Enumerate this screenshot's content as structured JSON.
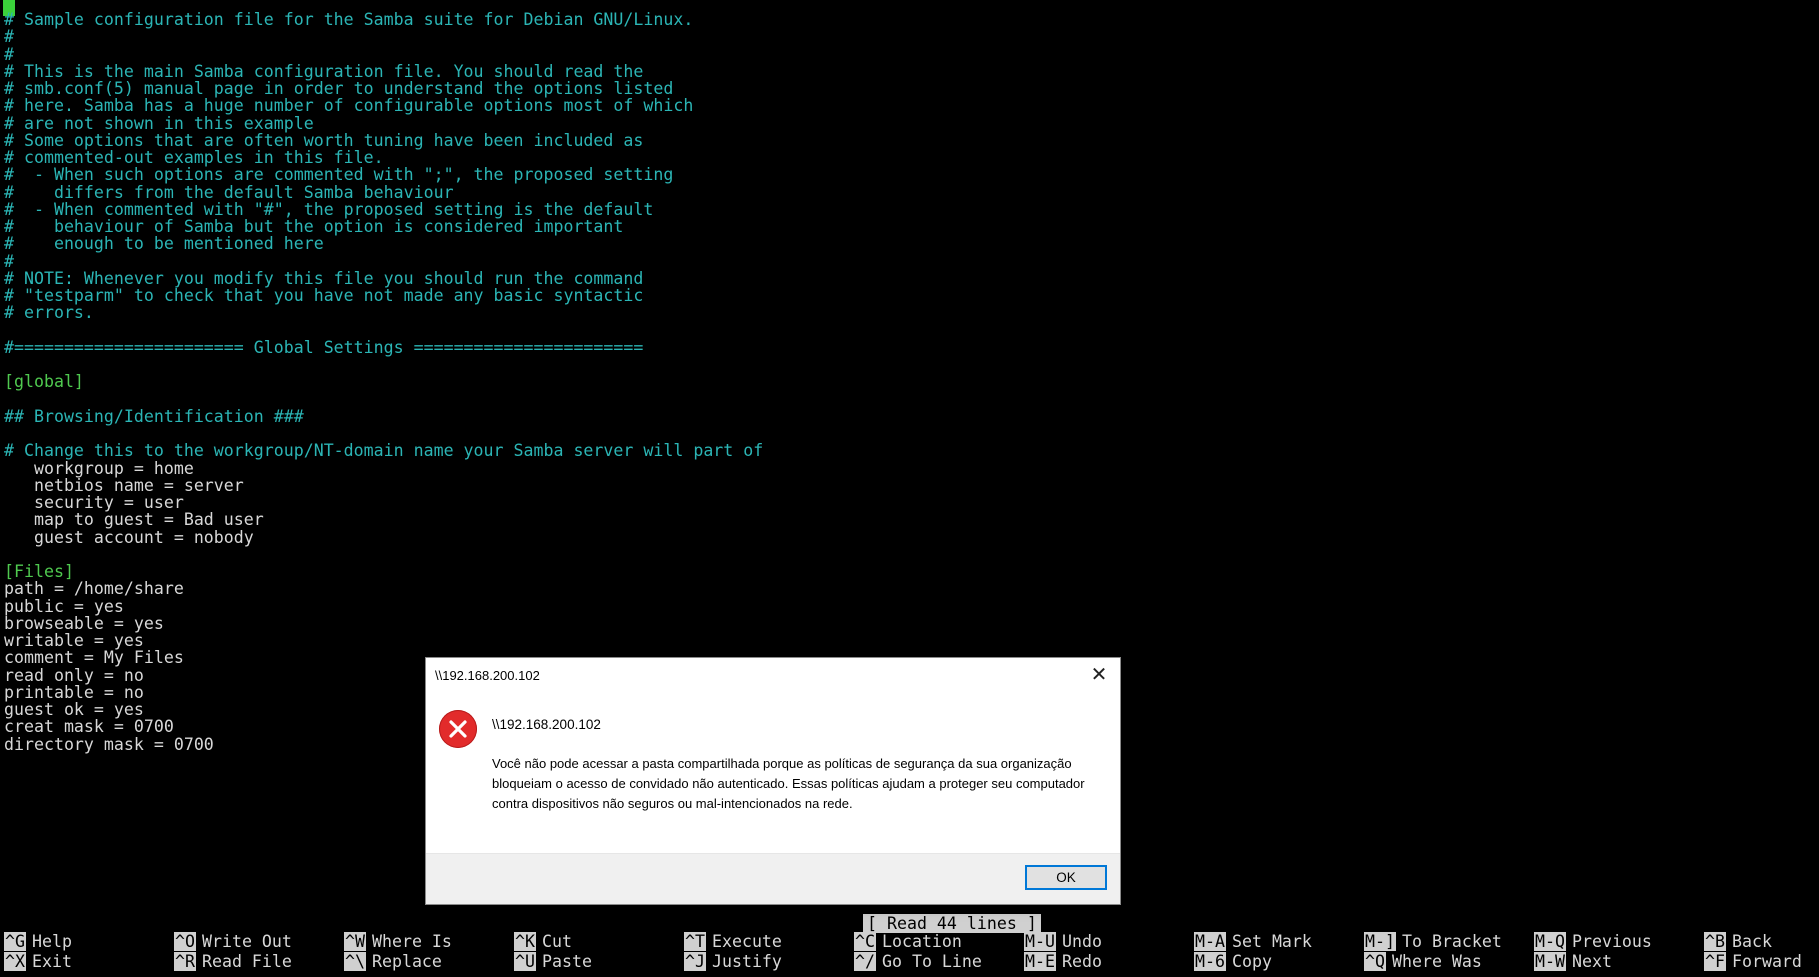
{
  "editor": {
    "cursor_char": "#",
    "lines": [
      {
        "text": "# Sample configuration file for the Samba suite for Debian GNU/Linux.",
        "color": "cyan"
      },
      {
        "text": "#",
        "color": "cyan"
      },
      {
        "text": "#",
        "color": "cyan"
      },
      {
        "text": "# This is the main Samba configuration file. You should read the",
        "color": "cyan"
      },
      {
        "text": "# smb.conf(5) manual page in order to understand the options listed",
        "color": "cyan"
      },
      {
        "text": "# here. Samba has a huge number of configurable options most of which",
        "color": "cyan"
      },
      {
        "text": "# are not shown in this example",
        "color": "cyan"
      },
      {
        "text": "# Some options that are often worth tuning have been included as",
        "color": "cyan"
      },
      {
        "text": "# commented-out examples in this file.",
        "color": "cyan"
      },
      {
        "text": "#  - When such options are commented with \";\", the proposed setting",
        "color": "cyan"
      },
      {
        "text": "#    differs from the default Samba behaviour",
        "color": "cyan"
      },
      {
        "text": "#  - When commented with \"#\", the proposed setting is the default",
        "color": "cyan"
      },
      {
        "text": "#    behaviour of Samba but the option is considered important",
        "color": "cyan"
      },
      {
        "text": "#    enough to be mentioned here",
        "color": "cyan"
      },
      {
        "text": "#",
        "color": "cyan"
      },
      {
        "text": "# NOTE: Whenever you modify this file you should run the command",
        "color": "cyan"
      },
      {
        "text": "# \"testparm\" to check that you have not made any basic syntactic",
        "color": "cyan"
      },
      {
        "text": "# errors.",
        "color": "cyan"
      },
      {
        "text": "",
        "color": "cyan"
      },
      {
        "text": "#======================= Global Settings =======================",
        "color": "cyan"
      },
      {
        "text": "",
        "color": "cyan"
      },
      {
        "text": "[global]",
        "color": "green"
      },
      {
        "text": "",
        "color": "cyan"
      },
      {
        "text": "## Browsing/Identification ###",
        "color": "cyan"
      },
      {
        "text": "",
        "color": "cyan"
      },
      {
        "text": "# Change this to the workgroup/NT-domain name your Samba server will part of",
        "color": "cyan"
      },
      {
        "text": "   workgroup = home",
        "color": "white"
      },
      {
        "text": "   netbios name = server",
        "color": "white"
      },
      {
        "text": "   security = user",
        "color": "white"
      },
      {
        "text": "   map to guest = Bad user",
        "color": "white"
      },
      {
        "text": "   guest account = nobody",
        "color": "white"
      },
      {
        "text": "",
        "color": "cyan"
      },
      {
        "text": "[Files]",
        "color": "green"
      },
      {
        "text": "path = /home/share",
        "color": "white"
      },
      {
        "text": "public = yes",
        "color": "white"
      },
      {
        "text": "browseable = yes",
        "color": "white"
      },
      {
        "text": "writable = yes",
        "color": "white"
      },
      {
        "text": "comment = My Files",
        "color": "white"
      },
      {
        "text": "read only = no",
        "color": "white"
      },
      {
        "text": "printable = no",
        "color": "white"
      },
      {
        "text": "guest ok = yes",
        "color": "white"
      },
      {
        "text": "creat mask = 0700",
        "color": "white"
      },
      {
        "text": "directory mask = 0700",
        "color": "white"
      }
    ],
    "status": "[ Read 44 lines ]",
    "shortcuts": [
      [
        {
          "key": "^G",
          "label": "Help"
        },
        {
          "key": "^X",
          "label": "Exit"
        }
      ],
      [
        {
          "key": "^O",
          "label": "Write Out"
        },
        {
          "key": "^R",
          "label": "Read File"
        }
      ],
      [
        {
          "key": "^W",
          "label": "Where Is"
        },
        {
          "key": "^\\",
          "label": "Replace"
        }
      ],
      [
        {
          "key": "^K",
          "label": "Cut"
        },
        {
          "key": "^U",
          "label": "Paste"
        }
      ],
      [
        {
          "key": "^T",
          "label": "Execute"
        },
        {
          "key": "^J",
          "label": "Justify"
        }
      ],
      [
        {
          "key": "^C",
          "label": "Location"
        },
        {
          "key": "^/",
          "label": "Go To Line"
        }
      ],
      [
        {
          "key": "M-U",
          "label": "Undo"
        },
        {
          "key": "M-E",
          "label": "Redo"
        }
      ],
      [
        {
          "key": "M-A",
          "label": "Set Mark"
        },
        {
          "key": "M-6",
          "label": "Copy"
        }
      ],
      [
        {
          "key": "M-]",
          "label": "To Bracket"
        },
        {
          "key": "^Q",
          "label": "Where Was"
        }
      ],
      [
        {
          "key": "M-Q",
          "label": "Previous"
        },
        {
          "key": "M-W",
          "label": "Next"
        }
      ],
      [
        {
          "key": "^B",
          "label": "Back"
        },
        {
          "key": "^F",
          "label": "Forward"
        }
      ]
    ]
  },
  "dialog": {
    "title": "\\\\192.168.200.102",
    "heading": "\\\\192.168.200.102",
    "message": "Você não pode acessar a pasta compartilhada porque as políticas de segurança da sua organização bloqueiam o acesso de convidado não autenticado. Essas políticas ajudam a proteger seu computador contra dispositivos não seguros ou mal-intencionados na rede.",
    "ok_label": "OK",
    "close_symbol": "✕",
    "icon": "error-icon"
  },
  "colors": {
    "background": "#000000",
    "comment": "#2bb5b5",
    "section": "#4fc94f",
    "text": "#d8d8d8",
    "error_icon": "#e22b2b",
    "ok_border": "#0078d7"
  }
}
